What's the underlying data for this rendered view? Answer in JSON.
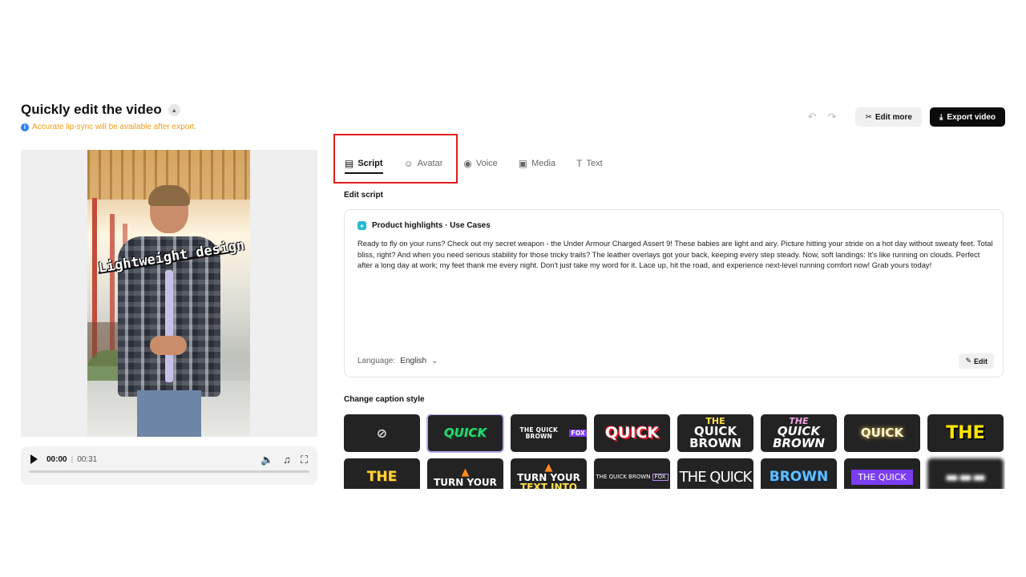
{
  "header": {
    "title": "Quickly edit the video",
    "notice": "Accurate lip-sync will be available after export.",
    "edit_more": "Edit more",
    "export": "Export video"
  },
  "preview": {
    "caption": "Lightweight design",
    "current_time": "00:00",
    "duration": "00:31"
  },
  "tabs": [
    {
      "label": "Script",
      "icon": "script-icon",
      "active": true
    },
    {
      "label": "Avatar",
      "icon": "avatar-icon"
    },
    {
      "label": "Voice",
      "icon": "voice-icon"
    },
    {
      "label": "Media",
      "icon": "media-icon"
    },
    {
      "label": "Text",
      "icon": "text-icon"
    }
  ],
  "script": {
    "section_label": "Edit script",
    "card_title": "Product highlights · Use Cases",
    "body": "Ready to fly on your runs? Check out my secret weapon - the Under Armour Charged Assert 9! These babies are light and airy. Picture hitting your stride on a hot day without sweaty feet. Total bliss, right? And when you need serious stability for those tricky trails? The leather overlays got your back, keeping every step steady. Now, soft landings: It's like running on clouds. Perfect after a long day at work; my feet thank me every night. Don't just take my word for it. Lace up, hit the road, and experience next-level running comfort now! Grab yours today!",
    "language_label": "Language:",
    "language_value": "English",
    "edit_label": "Edit"
  },
  "captions": {
    "section_label": "Change caption style",
    "tiles": {
      "t2": "QUICK",
      "t3a": "THE QUICK BROWN",
      "t3b": "FOX",
      "t4": "QUICK",
      "t5a": "THE",
      "t5b": "QUICK",
      "t5c": "BROWN",
      "t6a": "THE",
      "t6b": "QUICK",
      "t6c": "BROWN",
      "t7": "QUICK",
      "t8": "THE",
      "t9": "THE",
      "t10": "TURN YOUR",
      "t11a": "TURN YOUR",
      "t11b": "TEXT INTO",
      "t12a": "THE QUICK BROWN",
      "t12b": "FOX",
      "t13": "THE QUICK",
      "t14": "BROWN",
      "t15": "THE QUICK"
    }
  },
  "colors": {
    "accent": "#111111",
    "highlight_box": "#e01b1b",
    "notice": "#f39c12"
  }
}
